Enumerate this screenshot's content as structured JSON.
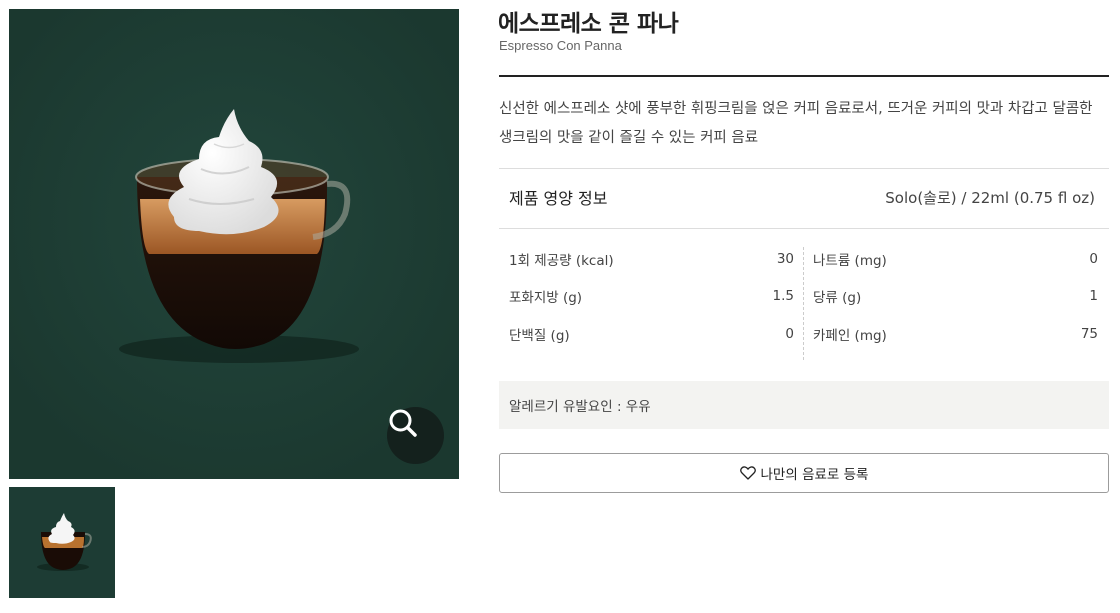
{
  "product": {
    "title": "에스프레소 콘 파나",
    "subtitle": "Espresso Con Panna",
    "description": "신선한 에스프레소 샷에 풍부한 휘핑크림을 얹은 커피 음료로서, 뜨거운 커피의 맛과 차갑고 달콤한 생크림의 맛을 같이 즐길 수 있는 커피 음료"
  },
  "nutrition": {
    "title": "제품 영양 정보",
    "size": "Solo(솔로) / 22ml (0.75 fl oz)",
    "left": [
      {
        "label": "1회 제공량 (kcal)",
        "value": "30"
      },
      {
        "label": "포화지방 (g)",
        "value": "1.5"
      },
      {
        "label": "단백질 (g)",
        "value": "0"
      }
    ],
    "right": [
      {
        "label": "나트륨 (mg)",
        "value": "0"
      },
      {
        "label": "당류 (g)",
        "value": "1"
      },
      {
        "label": "카페인 (mg)",
        "value": "75"
      }
    ]
  },
  "allergy": {
    "text": "알레르기 유발요인 : 우유"
  },
  "favorite": {
    "label": "나만의 음료로 등록",
    "icon": "heart-icon"
  },
  "images": {
    "zoom_icon": "magnifier-icon",
    "background_color": "#1d3c34"
  }
}
